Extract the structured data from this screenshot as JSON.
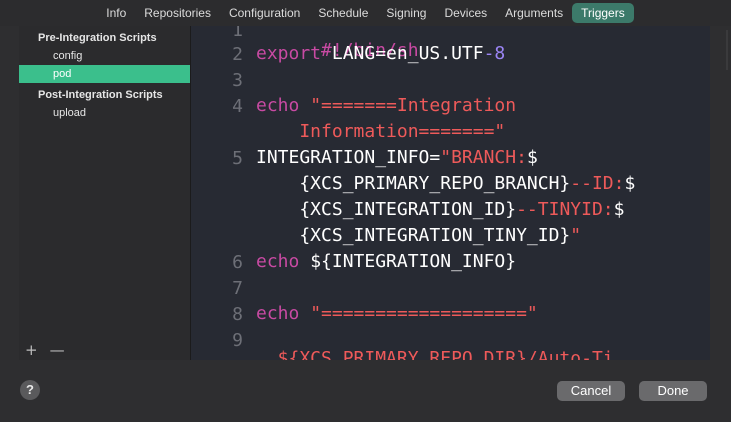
{
  "tabs": [
    {
      "label": "Info"
    },
    {
      "label": "Repositories"
    },
    {
      "label": "Configuration"
    },
    {
      "label": "Schedule"
    },
    {
      "label": "Signing"
    },
    {
      "label": "Devices"
    },
    {
      "label": "Arguments"
    },
    {
      "label": "Triggers",
      "active": true
    }
  ],
  "sidebar": {
    "groups": [
      {
        "title": "Pre-Integration Scripts",
        "items": [
          {
            "label": "config"
          },
          {
            "label": "pod",
            "selected": true
          }
        ]
      },
      {
        "title": "Post-Integration Scripts",
        "items": [
          {
            "label": "upload"
          }
        ]
      }
    ],
    "add_label": "+",
    "remove_label": "—"
  },
  "editor": {
    "line_numbers": [
      "1",
      "2",
      "3",
      "4",
      "5",
      "6",
      "7",
      "8",
      "9"
    ],
    "lines": {
      "l1": "#!/bin/sh",
      "l2_kw": "export",
      "l2_a": " LANG=en_US.UTF",
      "l2_b": "-8",
      "l4_kw": "echo",
      "l4_str": " \"=======Integration",
      "l4_cont": "    Information=======\"",
      "l5_plain": "INTEGRATION_INFO=",
      "l5_str": "\"BRANCH:",
      "l5_dollar": "$",
      "l5b_plain": "    {XCS_PRIMARY_REPO_BRANCH}",
      "l5b_str": "--ID:",
      "l5b_dollar": "$",
      "l5c_plain": "    {XCS_INTEGRATION_ID}",
      "l5c_str": "--TINYID:",
      "l5c_dollar": "$",
      "l5d_plain": "    {XCS_INTEGRATION_TINY_ID}",
      "l5d_str": "\"",
      "l6_kw": "echo",
      "l6_plain": " ${INTEGRATION_INFO}",
      "l8_kw": "echo",
      "l8_str": " \"===================\"",
      "l10_partial": "  ${XCS_PRIMARY_REPO_DIR}/Auto-Ti..."
    }
  },
  "colors": {
    "keyword": "#c84aa3",
    "string": "#ee5a5a",
    "active_tab": "#3c7a6a",
    "selected_item": "#3bbf8c"
  },
  "footer": {
    "help_label": "?",
    "cancel_label": "Cancel",
    "done_label": "Done"
  }
}
